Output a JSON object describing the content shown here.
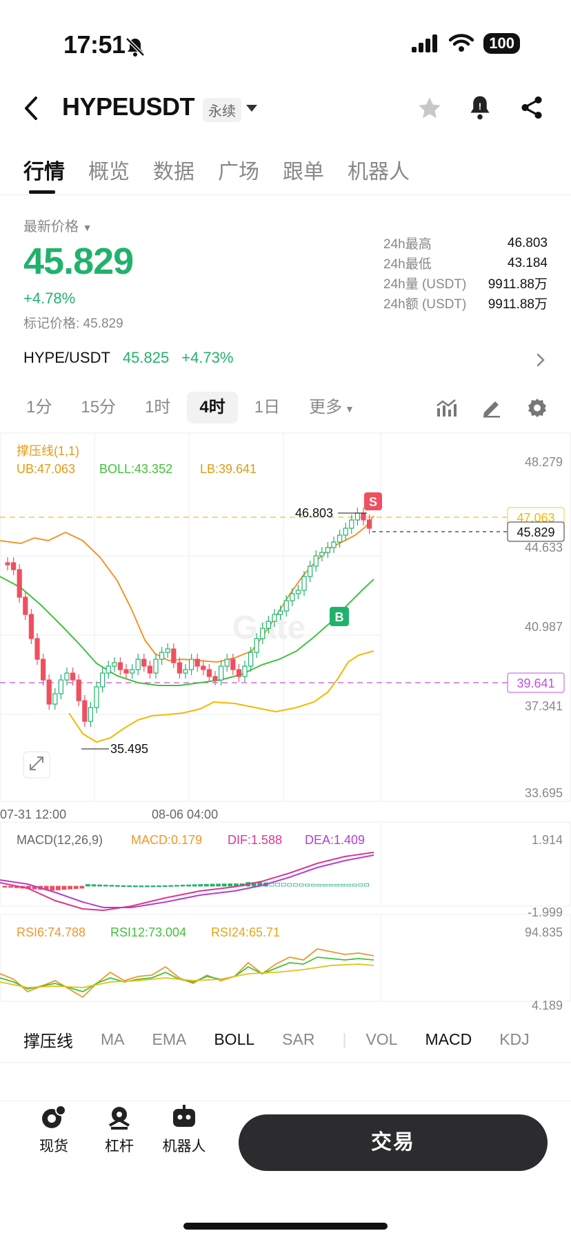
{
  "status": {
    "time": "17:51",
    "battery": "100"
  },
  "header": {
    "symbol": "HYPEUSDT",
    "contract_tag": "永续"
  },
  "tabs": [
    "行情",
    "概览",
    "数据",
    "广场",
    "跟单",
    "机器人"
  ],
  "price": {
    "label": "最新价格",
    "last": "45.829",
    "change": "+4.78%",
    "mark": "标记价格: 45.829"
  },
  "stats": [
    {
      "k": "24h最高",
      "v": "46.803"
    },
    {
      "k": "24h最低",
      "v": "43.184"
    },
    {
      "k": "24h量 (USDT)",
      "v": "9911.88万"
    },
    {
      "k": "24h额 (USDT)",
      "v": "9911.88万"
    }
  ],
  "spot_pair": {
    "name": "HYPE/USDT",
    "price": "45.825",
    "change": "+4.73%"
  },
  "timeframes": [
    "1分",
    "15分",
    "1时",
    "4时",
    "1日",
    "更多"
  ],
  "chart": {
    "indicator_name": "撑压线(1,1)",
    "ub": "UB:47.063",
    "boll": "BOLL:43.352",
    "lb": "LB:39.641",
    "y_ticks": [
      "48.279",
      "44.633",
      "40.987",
      "37.341",
      "33.695"
    ],
    "line_upper": "47.063",
    "current": "45.829",
    "line_lower": "39.641",
    "high_label": "46.803",
    "low_label": "35.495",
    "x_ticks": [
      "07-31 12:00",
      "08-06 04:00"
    ],
    "sell_mark": "S",
    "buy_mark": "B"
  },
  "macd": {
    "name": "MACD(12,26,9)",
    "macd": "MACD:0.179",
    "dif": "DIF:1.588",
    "dea": "DEA:1.409",
    "y_ticks": [
      "1.914",
      "-1.999"
    ]
  },
  "rsi": {
    "rsi6": "RSI6:74.788",
    "rsi12": "RSI12:73.004",
    "rsi24": "RSI24:65.71",
    "y_ticks": [
      "94.835",
      "4.189"
    ]
  },
  "indicators": [
    "撑压线",
    "MA",
    "EMA",
    "BOLL",
    "SAR",
    "VOL",
    "MACD",
    "KDJ"
  ],
  "bottom_nav": [
    "现货",
    "杠杆",
    "机器人"
  ],
  "trade_button": "交易",
  "colors": {
    "up": "#20b26c",
    "down": "#ef4f5f",
    "ub": "#f5b800",
    "boll_mid": "#3fc23a",
    "lb_purple": "#c050e0"
  }
}
